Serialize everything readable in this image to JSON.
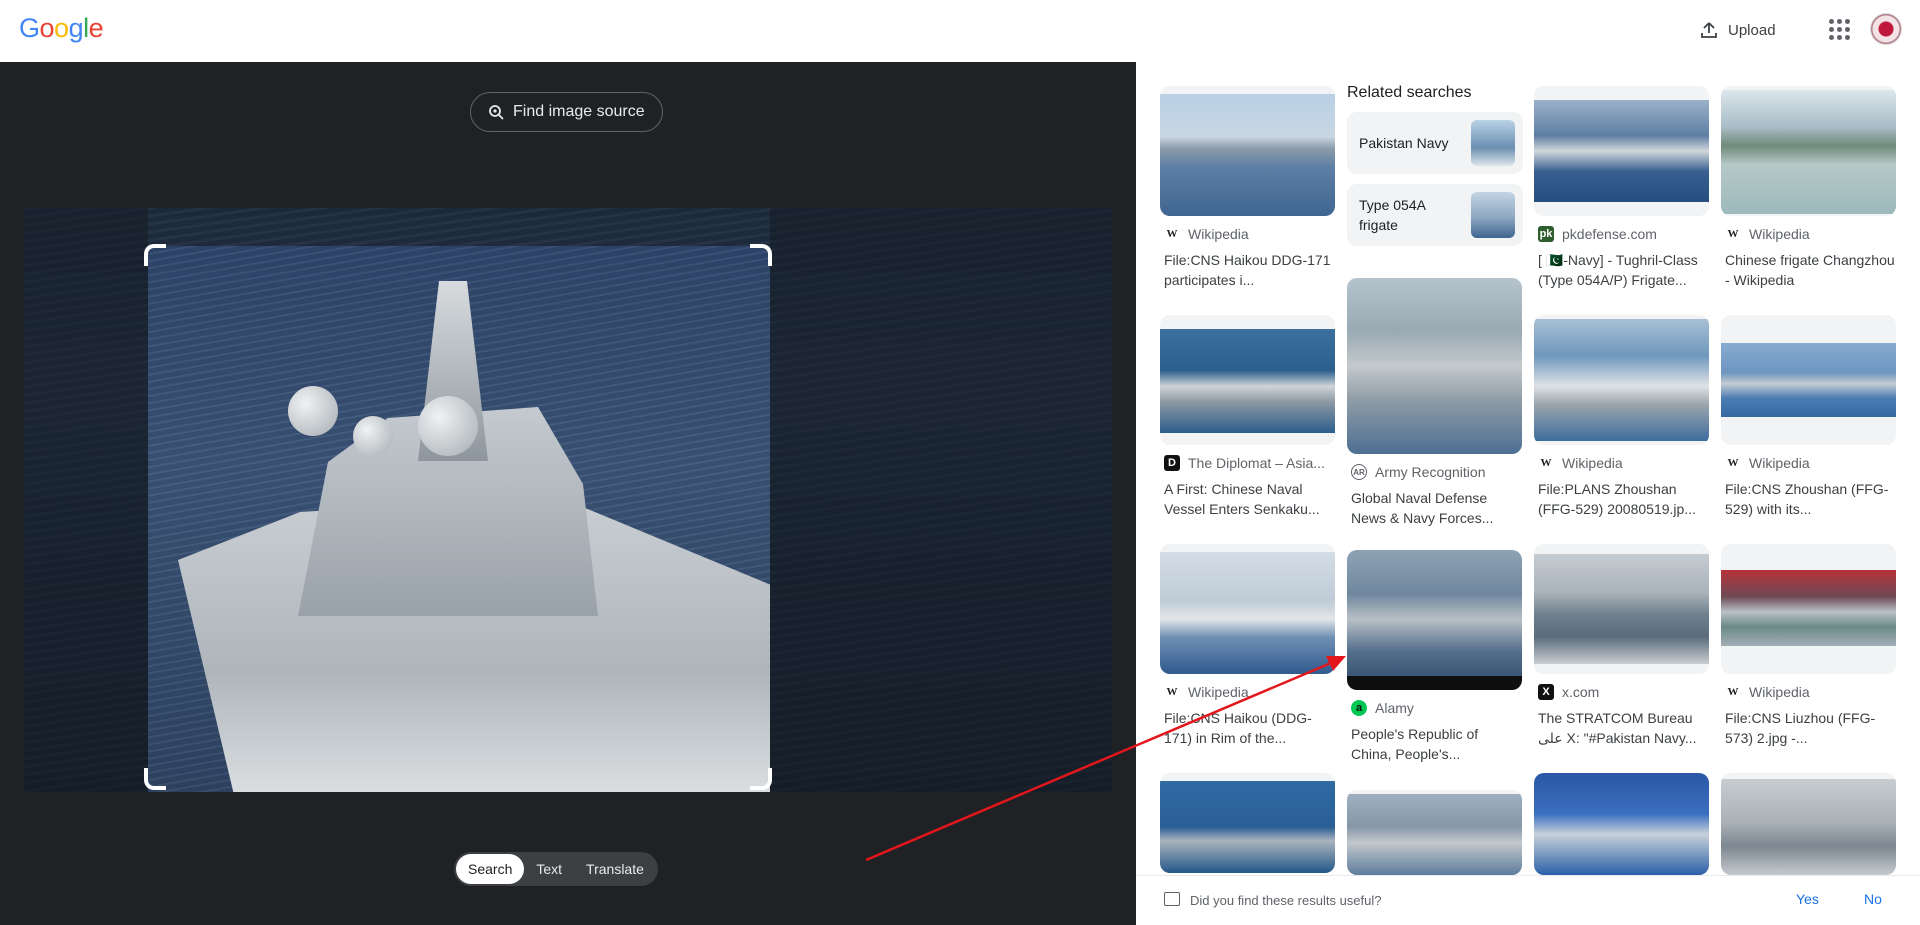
{
  "header": {
    "logo_text": "Google",
    "upload_label": "Upload"
  },
  "viewer": {
    "find_source_label": "Find image source",
    "modes": [
      "Search",
      "Text",
      "Translate"
    ],
    "active_mode": "Search"
  },
  "related": {
    "heading": "Related searches",
    "items": [
      {
        "label": "Pakistan Navy"
      },
      {
        "label": "Type 054A frigate"
      }
    ]
  },
  "results": [
    {
      "source": "Wikipedia",
      "favicon": "W",
      "title": "File:CNS Haikou DDG-171 participates i..."
    },
    {
      "source": "pkdefense.com",
      "favicon": "pk",
      "title": "[ 🇵🇰-Navy] - Tughril-Class (Type 054A/P) Frigate..."
    },
    {
      "source": "Wikipedia",
      "favicon": "W",
      "title": "Chinese frigate Changzhou - Wikipedia"
    },
    {
      "source": "The Diplomat – Asia...",
      "favicon": "D",
      "title": "A First: Chinese Naval Vessel Enters Senkaku..."
    },
    {
      "source": "Army Recognition",
      "favicon": "AR",
      "title": "Global Naval Defense News & Navy Forces..."
    },
    {
      "source": "Wikipedia",
      "favicon": "W",
      "title": "File:PLANS Zhoushan (FFG-529) 20080519.jp..."
    },
    {
      "source": "Wikipedia",
      "favicon": "W",
      "title": "File:CNS Zhoushan (FFG-529) with its..."
    },
    {
      "source": "Wikipedia",
      "favicon": "W",
      "title": "File:CNS Haikou (DDG-171) in Rim of the..."
    },
    {
      "source": "Alamy",
      "favicon": "a",
      "title": "People's Republic of China, People's..."
    },
    {
      "source": "x.com",
      "favicon": "X",
      "title": "The STRATCOM Bureau علی X: \"#Pakistan Navy..."
    },
    {
      "source": "Wikipedia",
      "favicon": "W",
      "title": "File:CNS Liuzhou (FFG-573) 2.jpg -..."
    }
  ],
  "feedback": {
    "question": "Did you find these results useful?",
    "yes_label": "Yes",
    "no_label": "No"
  },
  "colors": {
    "accent": "#1a73e8",
    "viewer_bg": "#202124",
    "annotation_arrow": "#e3161b"
  }
}
